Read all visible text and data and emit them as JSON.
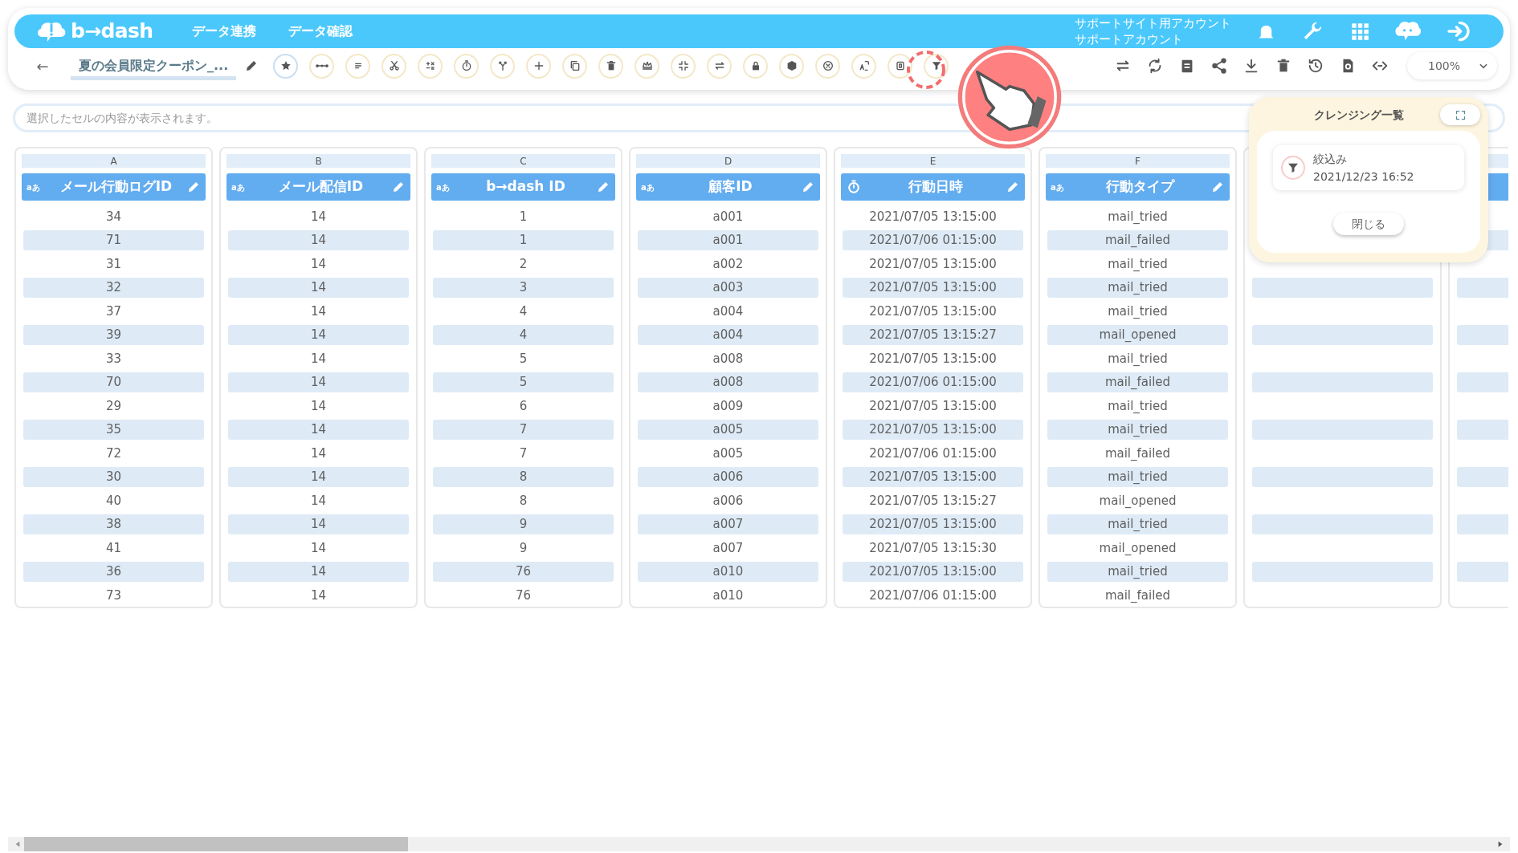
{
  "header": {
    "logo": "b→dash",
    "nav": [
      "データ連携",
      "データ確認"
    ],
    "account": [
      "サポートサイト用アカウント",
      "サポートアカウント"
    ]
  },
  "toolbar": {
    "back": "←",
    "title": "夏の会員限定クーポン_...",
    "zoom": "100%"
  },
  "cell_viewer": {
    "placeholder": "選択したセルの内容が表示されます。"
  },
  "table": {
    "columns": [
      {
        "kind": "data",
        "letter": "A",
        "name": "メール行動ログID",
        "type_label": "aあ"
      },
      {
        "kind": "data",
        "letter": "B",
        "name": "メール配信ID",
        "type_label": "aあ"
      },
      {
        "kind": "data",
        "letter": "C",
        "name": "b→dash ID",
        "type_label": "aあ"
      },
      {
        "kind": "data",
        "letter": "D",
        "name": "顧客ID",
        "type_label": "aあ"
      },
      {
        "kind": "datetime",
        "letter": "E",
        "name": "行動日時"
      },
      {
        "kind": "data",
        "letter": "F",
        "name": "行動タイプ",
        "type_label": "aあ"
      },
      {
        "kind": "covered"
      },
      {
        "kind": "blank"
      }
    ],
    "rows": [
      [
        "34",
        "14",
        "1",
        "a001",
        "2021/07/05 13:15:00",
        "mail_tried"
      ],
      [
        "71",
        "14",
        "1",
        "a001",
        "2021/07/06 01:15:00",
        "mail_failed"
      ],
      [
        "31",
        "14",
        "2",
        "a002",
        "2021/07/05 13:15:00",
        "mail_tried"
      ],
      [
        "32",
        "14",
        "3",
        "a003",
        "2021/07/05 13:15:00",
        "mail_tried"
      ],
      [
        "37",
        "14",
        "4",
        "a004",
        "2021/07/05 13:15:00",
        "mail_tried"
      ],
      [
        "39",
        "14",
        "4",
        "a004",
        "2021/07/05 13:15:27",
        "mail_opened"
      ],
      [
        "33",
        "14",
        "5",
        "a008",
        "2021/07/05 13:15:00",
        "mail_tried"
      ],
      [
        "70",
        "14",
        "5",
        "a008",
        "2021/07/06 01:15:00",
        "mail_failed"
      ],
      [
        "29",
        "14",
        "6",
        "a009",
        "2021/07/05 13:15:00",
        "mail_tried"
      ],
      [
        "35",
        "14",
        "7",
        "a005",
        "2021/07/05 13:15:00",
        "mail_tried"
      ],
      [
        "72",
        "14",
        "7",
        "a005",
        "2021/07/06 01:15:00",
        "mail_failed"
      ],
      [
        "30",
        "14",
        "8",
        "a006",
        "2021/07/05 13:15:00",
        "mail_tried"
      ],
      [
        "40",
        "14",
        "8",
        "a006",
        "2021/07/05 13:15:27",
        "mail_opened"
      ],
      [
        "38",
        "14",
        "9",
        "a007",
        "2021/07/05 13:15:00",
        "mail_tried"
      ],
      [
        "41",
        "14",
        "9",
        "a007",
        "2021/07/05 13:15:30",
        "mail_opened"
      ],
      [
        "36",
        "14",
        "76",
        "a010",
        "2021/07/05 13:15:00",
        "mail_tried"
      ],
      [
        "73",
        "14",
        "76",
        "a010",
        "2021/07/06 01:15:00",
        "mail_failed"
      ]
    ]
  },
  "cleansing_panel": {
    "title": "クレンジング一覧",
    "items": [
      {
        "name": "絞込み",
        "time": "2021/12/23 16:52"
      }
    ],
    "close": "閉じる"
  }
}
